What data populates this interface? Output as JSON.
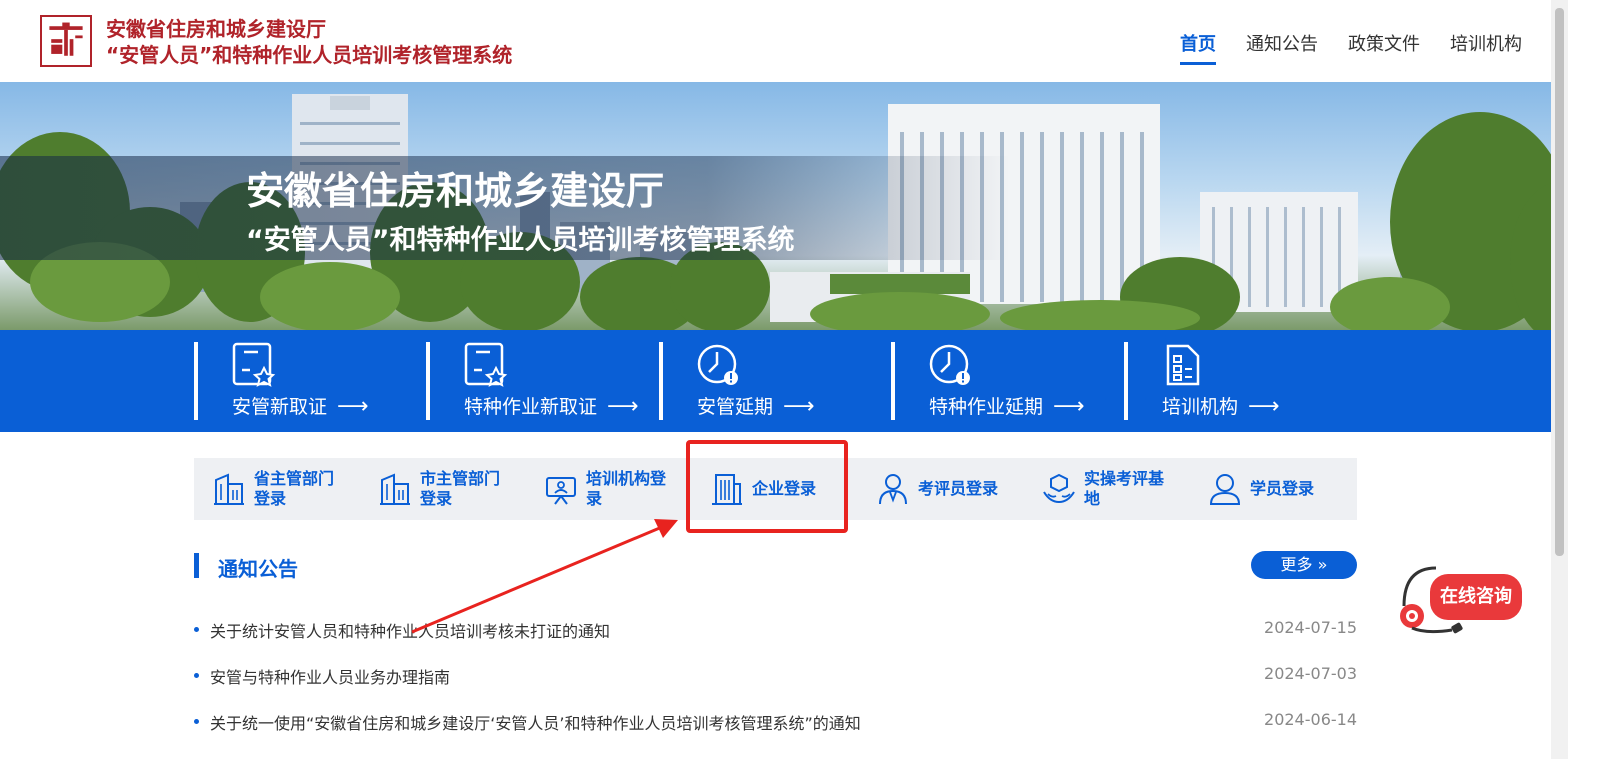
{
  "header": {
    "title_line1": "安徽省住房和城乡建设厅",
    "title_line2": "“安管人员”和特种作业人员培训考核管理系统",
    "nav": [
      {
        "label": "首页",
        "active": true
      },
      {
        "label": "通知公告"
      },
      {
        "label": "政策文件"
      },
      {
        "label": "培训机构"
      }
    ]
  },
  "banner": {
    "title": "安徽省住房和城乡建设厅",
    "subtitle": "“安管人员”和特种作业人员培训考核管理系统"
  },
  "quick_actions": [
    {
      "label": "安管新取证",
      "icon": "certificate-star-icon"
    },
    {
      "label": "特种作业新取证",
      "icon": "certificate-star-icon"
    },
    {
      "label": "安管延期",
      "icon": "clock-alert-icon"
    },
    {
      "label": "特种作业延期",
      "icon": "clock-alert-icon"
    },
    {
      "label": "培训机构",
      "icon": "document-list-icon"
    }
  ],
  "arrow_glyph": "⟶",
  "logins": [
    {
      "label": "省主管部门登录",
      "line1": "省主管部门",
      "line2": "登录",
      "icon": "building-icon"
    },
    {
      "label": "市主管部门登录",
      "line1": "市主管部门",
      "line2": "登录",
      "icon": "building-icon"
    },
    {
      "label": "培训机构登录",
      "line1": "培训机构登",
      "line2": "录",
      "icon": "presentation-board-icon"
    },
    {
      "label": "企业登录",
      "line1": "企业登录",
      "line2": "",
      "icon": "office-building-icon"
    },
    {
      "label": "考评员登录",
      "line1": "考评员登录",
      "line2": "",
      "icon": "examiner-icon"
    },
    {
      "label": "实操考评基地",
      "line1": "实操考评基",
      "line2": "地",
      "icon": "hands-cube-icon"
    },
    {
      "label": "学员登录",
      "line1": "学员登录",
      "line2": "",
      "icon": "user-icon"
    }
  ],
  "notices": {
    "title": "通知公告",
    "more_label": "更多 »",
    "items": [
      {
        "text": "关于统计安管人员和特种作业人员培训考核未打证的通知",
        "date": "2024-07-15"
      },
      {
        "text": "安管与特种作业人员业务办理指南",
        "date": "2024-07-03"
      },
      {
        "text": "关于统一使用“安徽省住房和城乡建设厅‘安管人员’和特种作业人员培训考核管理系统”的通知",
        "date": "2024-06-14"
      }
    ]
  },
  "consult": {
    "label": "在线咨询"
  },
  "colors": {
    "brand_red": "#b0232a",
    "primary_blue": "#0a5fd6",
    "annotation_red": "#e8231f"
  }
}
